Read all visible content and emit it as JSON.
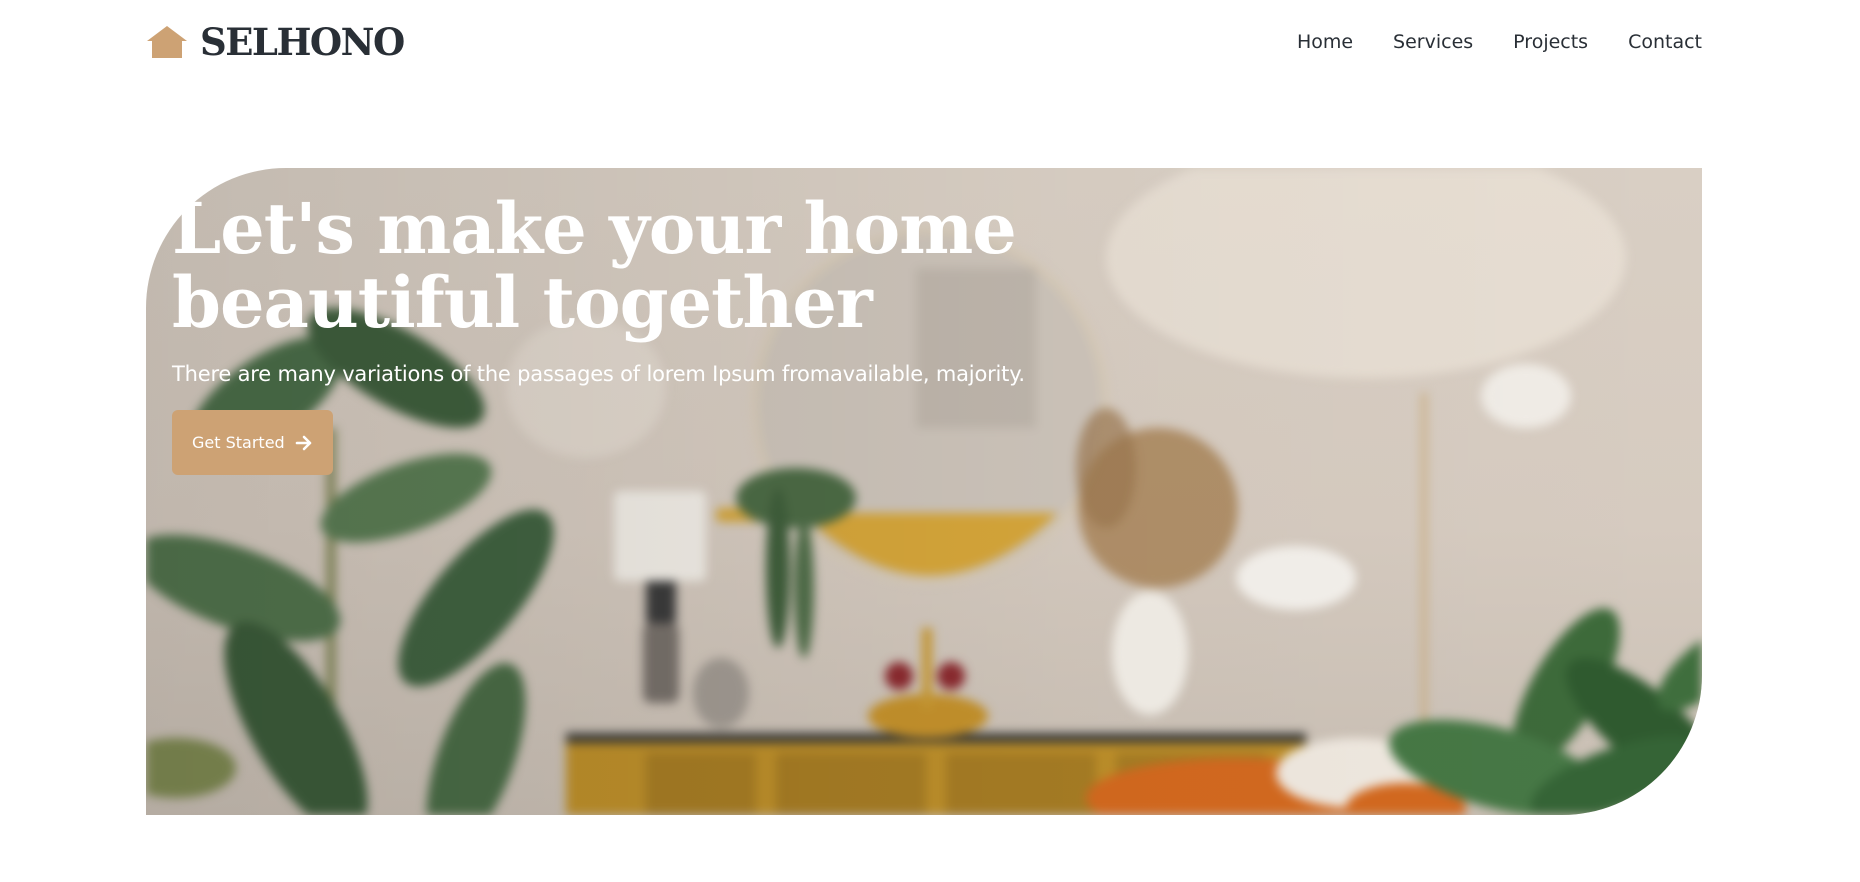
{
  "brand": {
    "name": "SELHONO",
    "logo_icon": "house-icon",
    "logo_color": "#CDA274"
  },
  "nav": {
    "items": [
      {
        "label": "Home"
      },
      {
        "label": "Services"
      },
      {
        "label": "Projects"
      },
      {
        "label": "Contact"
      }
    ]
  },
  "hero": {
    "title_line1": "Let's make your home",
    "title_line2": "beautiful together",
    "subtitle": "There are many variations of the passages of lorem Ipsum fromavailable, majority.",
    "cta_label": "Get Started",
    "cta_icon": "arrow-right-icon",
    "cta_color": "#CDA274"
  }
}
